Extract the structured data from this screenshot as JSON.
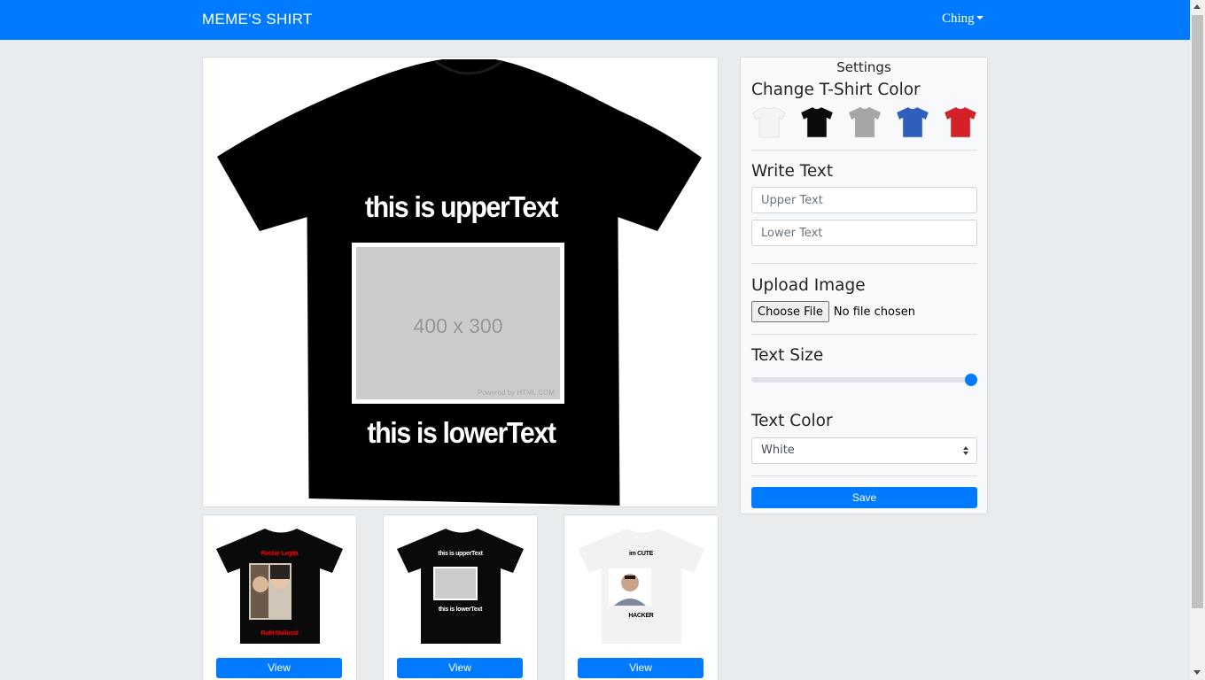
{
  "navbar": {
    "brand": "MEME'S SHIRT",
    "user_name": "Ching",
    "background": "#007bff"
  },
  "preview": {
    "shirt_color": "#000000",
    "upper_text": "this is upperText",
    "lower_text": "this is lowerText",
    "text_color": "#ffffff",
    "image_placeholder_label": "400 x 300",
    "image_placeholder_credit": "Powered by HTML.COM"
  },
  "thumbnails": [
    {
      "shirt_color": "#0a0a0a",
      "upper_text": "Rechie Legita",
      "lower_text": "Ruth Malinsol",
      "text_color": "#ff0000",
      "image": "photo-couple",
      "view_label": "View"
    },
    {
      "shirt_color": "#0a0a0a",
      "upper_text": "this is upperText",
      "lower_text": "this is lowerText",
      "text_color": "#ffffff",
      "image": "placeholder",
      "view_label": "View"
    },
    {
      "shirt_color": "#f2f2f2",
      "upper_text": "im CUTE",
      "lower_text": "HACKER",
      "text_color": "#000000",
      "image": "photo-portrait",
      "view_label": "View"
    }
  ],
  "settings": {
    "title": "Settings",
    "shirt_color_heading": "Change T-Shirt Color",
    "shirt_colors": [
      {
        "name": "white-shirt",
        "color": "#f4f4f4"
      },
      {
        "name": "black-shirt",
        "color": "#0a0a0a"
      },
      {
        "name": "gray-shirt",
        "color": "#a6a6a6"
      },
      {
        "name": "blue-shirt",
        "color": "#2f5fbd"
      },
      {
        "name": "red-shirt",
        "color": "#d42127"
      }
    ],
    "write_text_heading": "Write Text",
    "upper_placeholder": "Upper Text",
    "lower_placeholder": "Lower Text",
    "upload_heading": "Upload Image",
    "choose_file_label": "Choose File",
    "file_status": "No file chosen",
    "text_size_heading": "Text Size",
    "text_size_value": 1.0,
    "text_color_heading": "Text Color",
    "text_color_selected": "White",
    "save_label": "Save",
    "accent": "#007bff"
  }
}
